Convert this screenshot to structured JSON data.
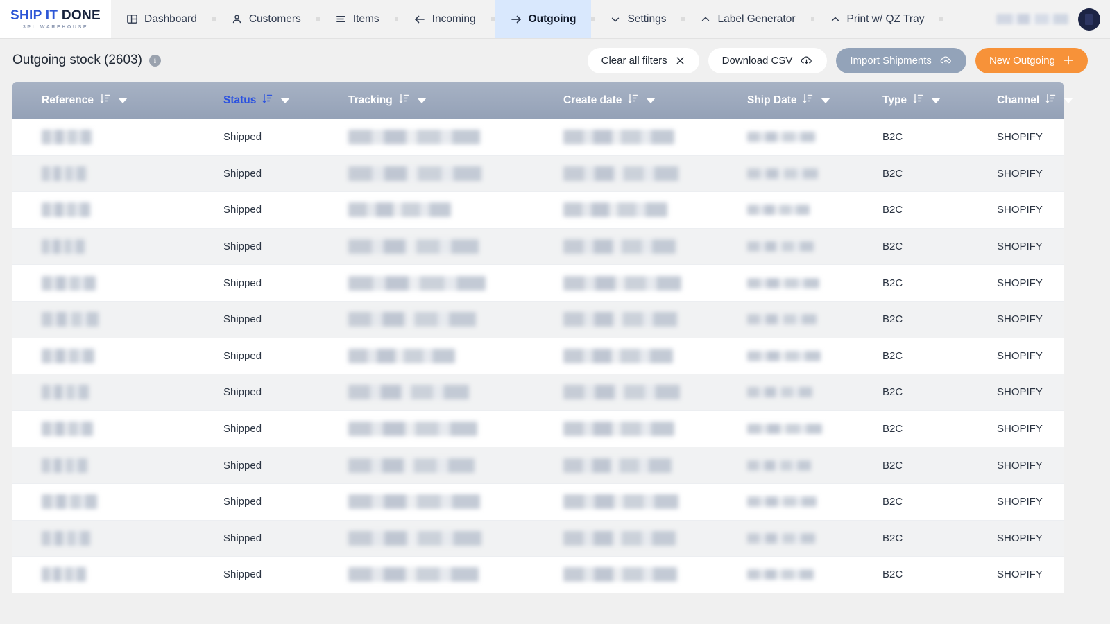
{
  "brand": {
    "name_left": "SHIP IT",
    "name_right": "DONE",
    "tagline": "3PL WAREHOUSE"
  },
  "nav": {
    "items": [
      {
        "label": "Dashboard",
        "icon": "dashboard-icon",
        "active": false
      },
      {
        "label": "Customers",
        "icon": "person-icon",
        "active": false
      },
      {
        "label": "Items",
        "icon": "list-icon",
        "active": false
      },
      {
        "label": "Incoming",
        "icon": "arrow-left-icon",
        "active": false
      },
      {
        "label": "Outgoing",
        "icon": "arrow-right-icon",
        "active": true
      },
      {
        "label": "Settings",
        "icon": "chevron-down-icon",
        "active": false
      },
      {
        "label": "Label Generator",
        "icon": "chevron-up-icon",
        "active": false
      },
      {
        "label": "Print w/ QZ Tray",
        "icon": "chevron-up-icon",
        "active": false
      }
    ]
  },
  "page": {
    "title": "Outgoing stock (2603)",
    "info_glyph": "i"
  },
  "toolbar": {
    "clear_filters_label": "Clear all filters",
    "download_csv_label": "Download CSV",
    "import_shipments_label": "Import Shipments",
    "new_outgoing_label": "New Outgoing"
  },
  "colors": {
    "accent_blue": "#2b52e0",
    "orange": "#f79239",
    "slate": "#93a3b9",
    "header_slate": "#94a1b7",
    "active_tab": "#d9e8fd"
  },
  "table": {
    "columns": [
      {
        "label": "Reference",
        "accent": false
      },
      {
        "label": "Status",
        "accent": true
      },
      {
        "label": "Tracking",
        "accent": false
      },
      {
        "label": "Create date",
        "accent": false
      },
      {
        "label": "Ship Date",
        "accent": false
      },
      {
        "label": "Type",
        "accent": false
      },
      {
        "label": "Channel",
        "accent": false
      }
    ],
    "rows": [
      {
        "reference": "",
        "status": "Shipped",
        "tracking": "",
        "create_date": "",
        "ship_date": "",
        "type": "B2C",
        "channel": "SHOPIFY"
      },
      {
        "reference": "",
        "status": "Shipped",
        "tracking": "",
        "create_date": "",
        "ship_date": "",
        "type": "B2C",
        "channel": "SHOPIFY"
      },
      {
        "reference": "",
        "status": "Shipped",
        "tracking": "",
        "create_date": "",
        "ship_date": "",
        "type": "B2C",
        "channel": "SHOPIFY"
      },
      {
        "reference": "",
        "status": "Shipped",
        "tracking": "",
        "create_date": "",
        "ship_date": "",
        "type": "B2C",
        "channel": "SHOPIFY"
      },
      {
        "reference": "",
        "status": "Shipped",
        "tracking": "",
        "create_date": "",
        "ship_date": "",
        "type": "B2C",
        "channel": "SHOPIFY"
      },
      {
        "reference": "",
        "status": "Shipped",
        "tracking": "",
        "create_date": "",
        "ship_date": "",
        "type": "B2C",
        "channel": "SHOPIFY"
      },
      {
        "reference": "",
        "status": "Shipped",
        "tracking": "",
        "create_date": "",
        "ship_date": "",
        "type": "B2C",
        "channel": "SHOPIFY"
      },
      {
        "reference": "",
        "status": "Shipped",
        "tracking": "",
        "create_date": "",
        "ship_date": "",
        "type": "B2C",
        "channel": "SHOPIFY"
      },
      {
        "reference": "",
        "status": "Shipped",
        "tracking": "",
        "create_date": "",
        "ship_date": "",
        "type": "B2C",
        "channel": "SHOPIFY"
      },
      {
        "reference": "",
        "status": "Shipped",
        "tracking": "",
        "create_date": "",
        "ship_date": "",
        "type": "B2C",
        "channel": "SHOPIFY"
      },
      {
        "reference": "",
        "status": "Shipped",
        "tracking": "",
        "create_date": "",
        "ship_date": "",
        "type": "B2C",
        "channel": "SHOPIFY"
      },
      {
        "reference": "",
        "status": "Shipped",
        "tracking": "",
        "create_date": "",
        "ship_date": "",
        "type": "B2C",
        "channel": "SHOPIFY"
      },
      {
        "reference": "",
        "status": "Shipped",
        "tracking": "",
        "create_date": "",
        "ship_date": "",
        "type": "B2C",
        "channel": "SHOPIFY"
      }
    ]
  }
}
